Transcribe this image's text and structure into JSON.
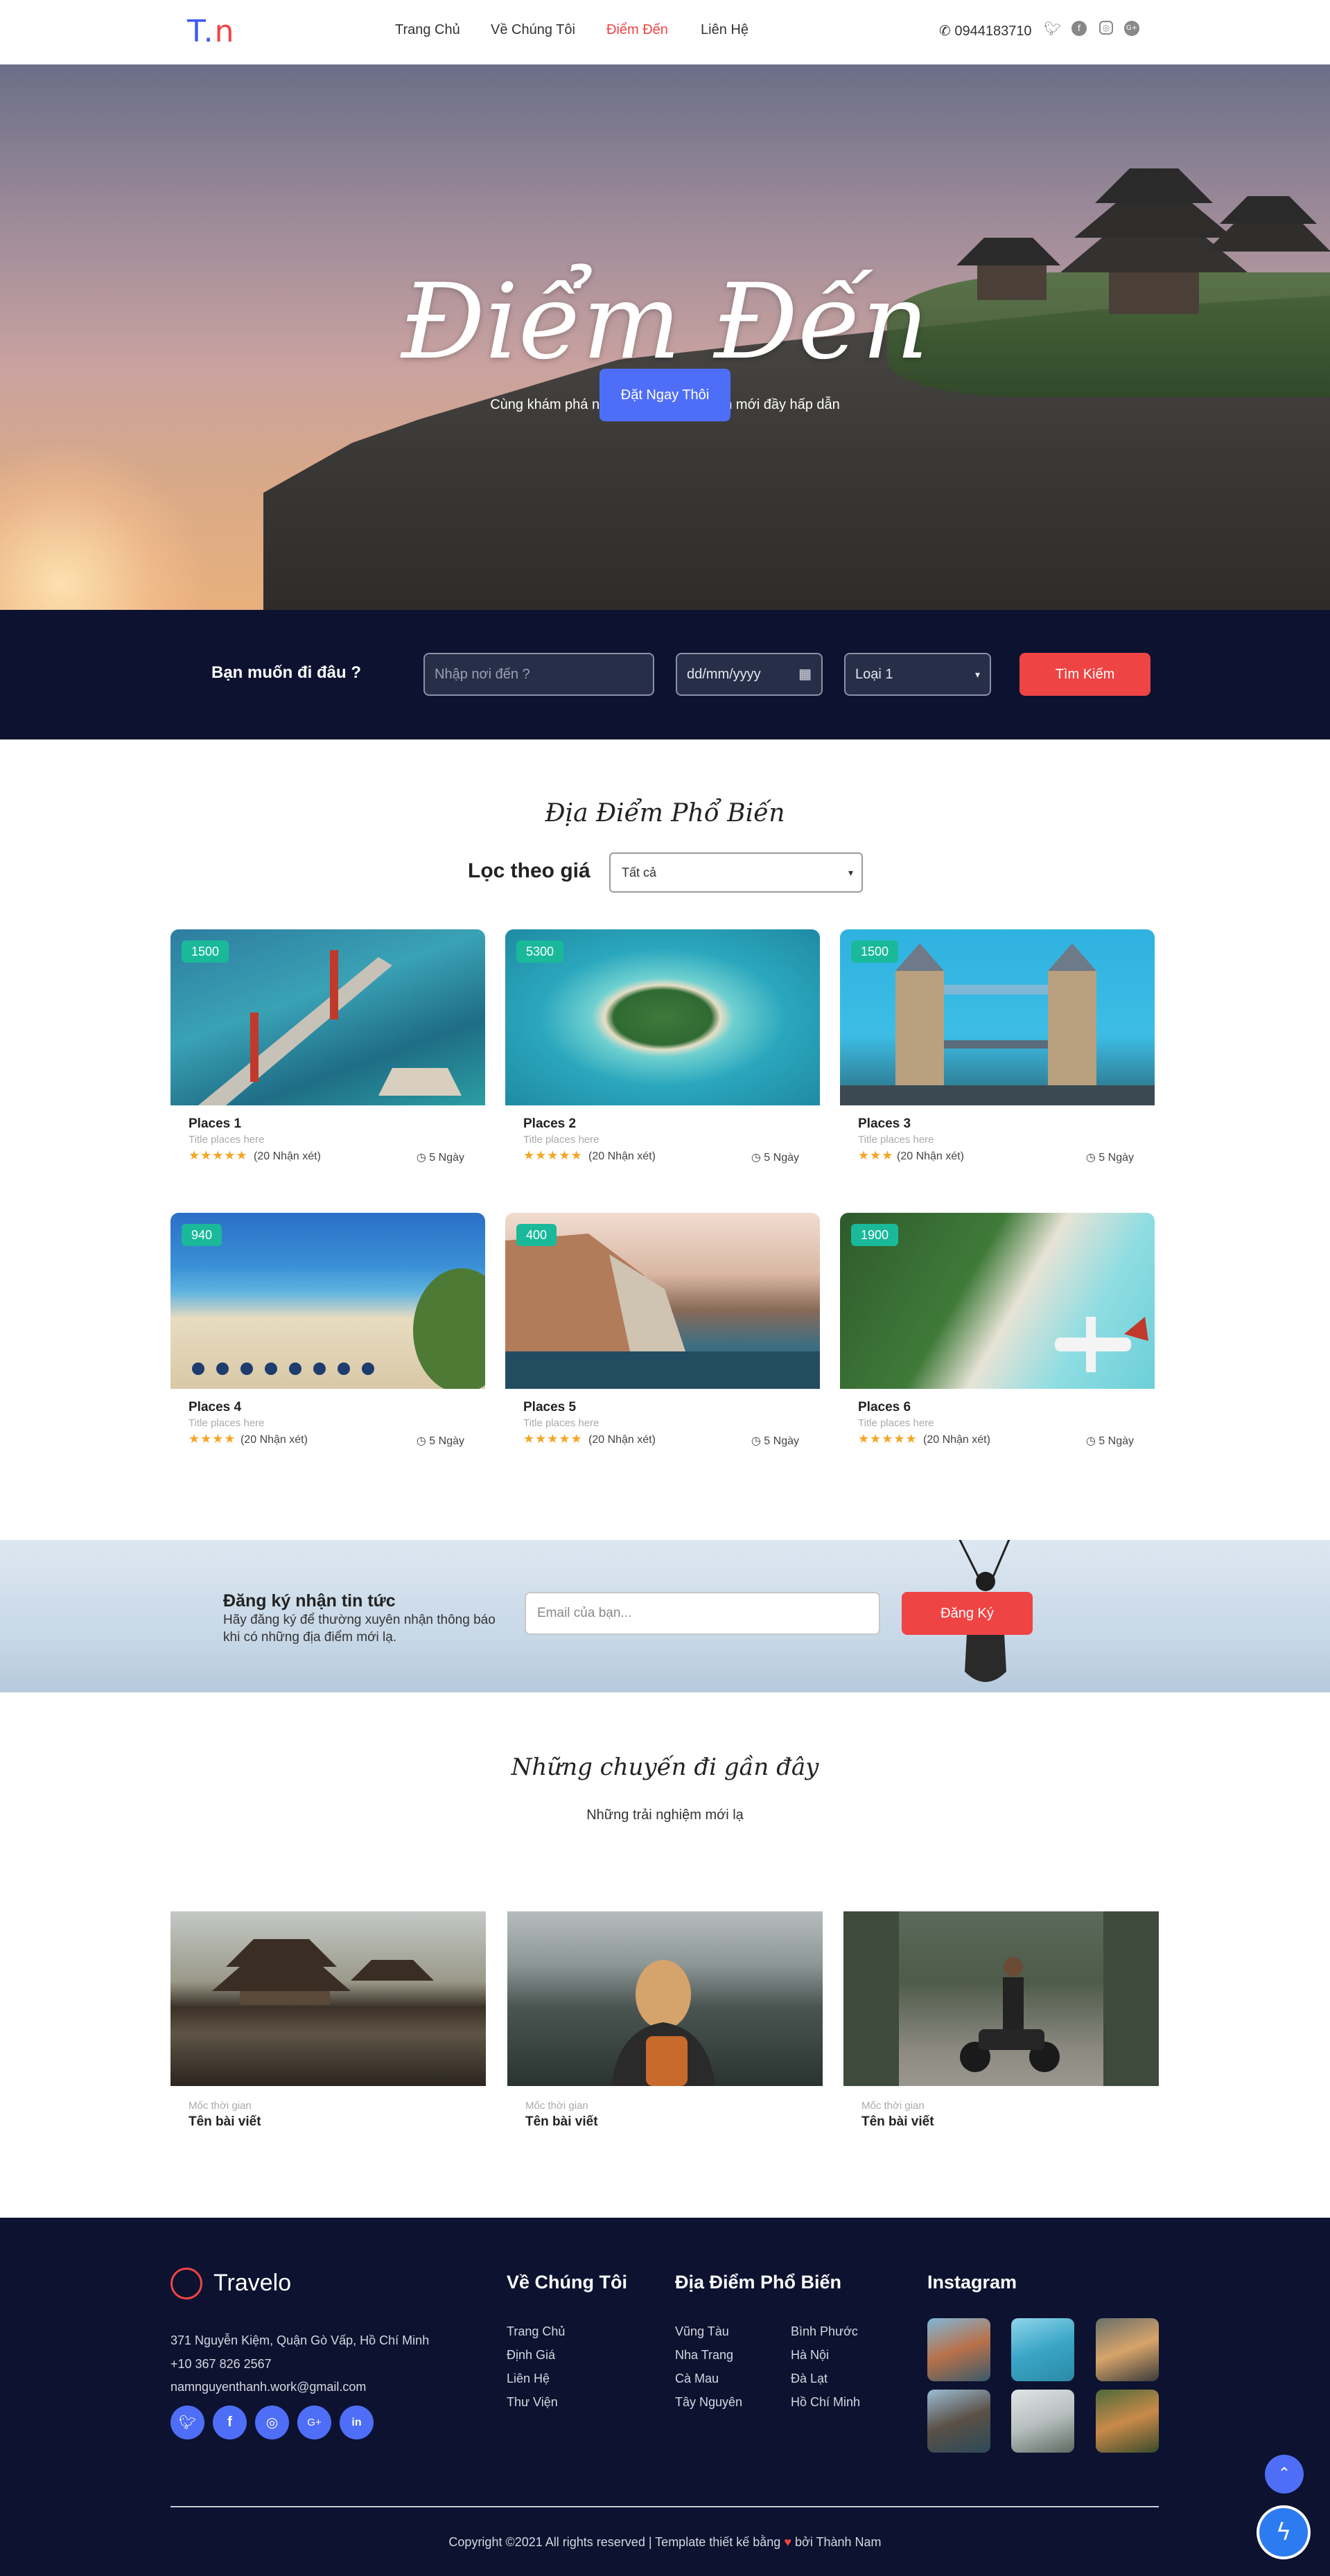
{
  "nav": {
    "logo_t": "T.",
    "logo_n": "n",
    "links": [
      "Trang Chủ",
      "Về Chúng Tôi",
      "Điểm Đến",
      "Liên Hệ"
    ],
    "active_index": 2,
    "phone": "0944183710",
    "social_icons": [
      "twitter-icon",
      "facebook-icon",
      "instagram-icon",
      "google-plus-icon"
    ]
  },
  "hero": {
    "title": "Điểm Đến",
    "subtitle": "Cùng khám phá những địa điểm du lịch mới đầy hấp dẫn",
    "cta": "Đặt Ngay Thôi"
  },
  "search": {
    "label": "Bạn muốn đi đâu ?",
    "destination_placeholder": "Nhập nơi đến ?",
    "date_placeholder": "dd/mm/yyyy",
    "type_value": "Loại 1",
    "button": "Tìm Kiếm"
  },
  "popular": {
    "title": "Địa Điểm Phổ Biến",
    "filter_label": "Lọc theo giá",
    "filter_value": "Tất cả",
    "places": [
      {
        "price": "1500",
        "name": "Places 1",
        "subtitle": "Title places here",
        "rating": 5,
        "reviews": "(20 Nhận xét)",
        "duration": "5 Ngày"
      },
      {
        "price": "5300",
        "name": "Places 2",
        "subtitle": "Title places here",
        "rating": 5,
        "reviews": "(20 Nhận xét)",
        "duration": "5 Ngày"
      },
      {
        "price": "1500",
        "name": "Places 3",
        "subtitle": "Title places here",
        "rating": 3,
        "reviews": "(20 Nhận xét)",
        "duration": "5 Ngày"
      },
      {
        "price": "940",
        "name": "Places 4",
        "subtitle": "Title places here",
        "rating": 4,
        "reviews": "(20 Nhận xét)",
        "duration": "5 Ngày"
      },
      {
        "price": "400",
        "name": "Places 5",
        "subtitle": "Title places here",
        "rating": 5,
        "reviews": "(20 Nhận xét)",
        "duration": "5 Ngày"
      },
      {
        "price": "1900",
        "name": "Places 6",
        "subtitle": "Title places here",
        "rating": 5,
        "reviews": "(20 Nhận xét)",
        "duration": "5 Ngày"
      }
    ]
  },
  "newsletter": {
    "title": "Đăng ký nhận tin tức",
    "description": "Hãy đăng ký để thường xuyên nhận thông báo khi có những địa điểm mới lạ.",
    "email_placeholder": "Email của bạn...",
    "button": "Đăng Ký"
  },
  "trips": {
    "title": "Những chuyến đi gần đây",
    "subtitle": "Những trải nghiệm mới lạ",
    "items": [
      {
        "time": "Mốc thời gian",
        "title": "Tên bài viết"
      },
      {
        "time": "Mốc thời gian",
        "title": "Tên bài viết"
      },
      {
        "time": "Mốc thời gian",
        "title": "Tên bài viết"
      }
    ]
  },
  "footer": {
    "brand": "Travelo",
    "address": "371 Nguyễn Kiệm, Quận Gò Vấp, Hồ Chí Minh",
    "phone": "+10 367 826 2567",
    "email": "namnguyenthanh.work@gmail.com",
    "about_title": "Về Chúng Tôi",
    "about_links": [
      "Trang Chủ",
      "Định Giá",
      "Liên Hệ",
      "Thư Viện"
    ],
    "places_title": "Địa Điểm Phổ Biến",
    "places_col1": [
      "Vũng Tàu",
      "Nha Trang",
      "Cà Mau",
      "Tây Nguyên"
    ],
    "places_col2": [
      "Bình Phước",
      "Hà Nội",
      "Đà Lạt",
      "Hồ Chí Minh"
    ],
    "instagram_title": "Instagram",
    "social_icons": [
      "twitter-icon",
      "facebook-icon",
      "instagram-icon",
      "google-plus-icon",
      "linkedin-icon"
    ],
    "copyright_before": "Copyright ©2021 All rights reserved | Template thiết kế bằng",
    "copyright_after": "bởi Thành Nam"
  },
  "colors": {
    "accent_blue": "#4f6ef7",
    "accent_red": "#ef4444",
    "dark_navy": "#0c1230",
    "badge_green": "#19b99a",
    "star": "#f5a623"
  }
}
